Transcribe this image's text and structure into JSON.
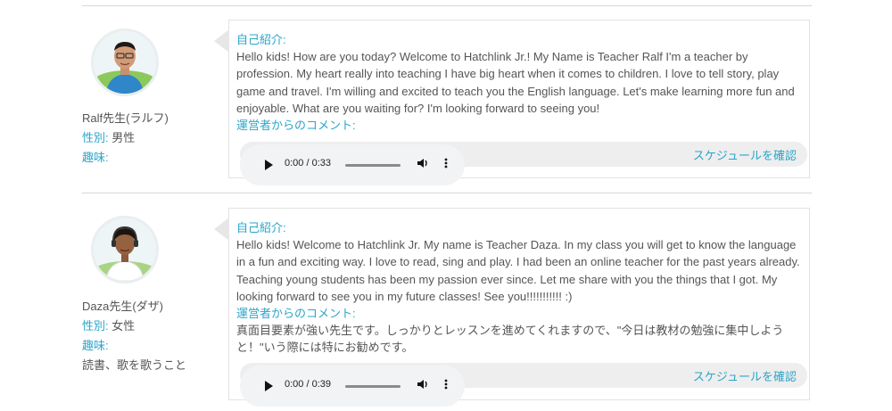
{
  "teachers": [
    {
      "name": "Ralf先生(ラルフ)",
      "gender_label": "性別:",
      "gender_value": "男性",
      "hobby_label": "趣味:",
      "hobby_value": "",
      "intro_title": "自己紹介:",
      "intro_text": "Hello kids! How are you today? Welcome to Hatchlink Jr.! My Name is Teacher Ralf I'm a teacher by profession. My heart really into teaching I have big heart when it comes to children. I love to tell story, play game and travel. I'm willing and excited to teach you the English language. Let's make learning more fun and enjoyable. What are you waiting for? I'm looking forward to seeing you!",
      "comment_title": "運営者からのコメント:",
      "comment_text": "",
      "schedule_label": "スケジュールを確認",
      "audio_time": "0:00 / 0:33",
      "shirt_color": "#2f86c9"
    },
    {
      "name": "Daza先生(ダザ)",
      "gender_label": "性別:",
      "gender_value": "女性",
      "hobby_label": "趣味:",
      "hobby_value": "読書、歌を歌うこと",
      "intro_title": "自己紹介:",
      "intro_text": "Hello kids! Welcome to Hatchlink Jr. My name is Teacher Daza. In my class you will get to know the language in a fun and exciting way. I love to read, sing and play. I had been an online teacher for the past years already. Teaching young students has been my passion ever since. Let me share with you the things that I got. My looking forward to see you in my future classes! See you!!!!!!!!!!! :)",
      "comment_title": "運営者からのコメント:",
      "comment_text": "真面目要素が強い先生です。しっかりとレッスンを進めてくれますので、\"今日は教材の勉強に集中しようと！\"いう際には特にお勧めです。",
      "schedule_label": "スケジュールを確認",
      "audio_time": "0:00 / 0:39",
      "shirt_color": "#ffffff"
    }
  ],
  "colors": {
    "accent": "#2aa5c9",
    "text": "#555555",
    "border": "#e2e2e2"
  }
}
